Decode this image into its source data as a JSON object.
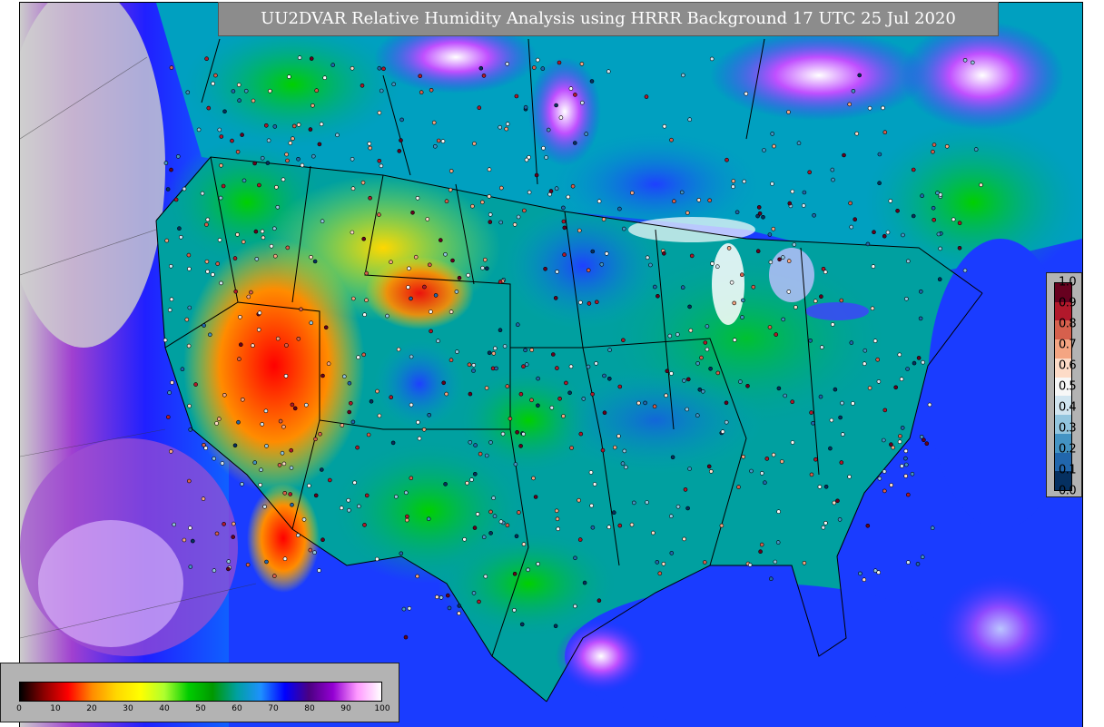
{
  "title": "UU2DVAR Relative Humidity Analysis using HRRR Background 17 UTC 25 Jul 2020",
  "field_colorbar": {
    "tick_labels": [
      "0",
      "10",
      "20",
      "30",
      "40",
      "50",
      "60",
      "70",
      "80",
      "90",
      "100"
    ],
    "range": [
      0,
      100
    ],
    "colors": [
      "#000000",
      "#8b0000",
      "#ff0000",
      "#ff8c00",
      "#ffd700",
      "#ffff00",
      "#adff2f",
      "#00cc00",
      "#009900",
      "#00a0a0",
      "#1e90ff",
      "#0000ff",
      "#4b0082",
      "#9400d3",
      "#ff99ff",
      "#ffffff"
    ]
  },
  "obs_colorbar": {
    "tick_labels": [
      "1.0",
      "0.9",
      "0.8",
      "0.7",
      "0.6",
      "0.5",
      "0.4",
      "0.3",
      "0.2",
      "0.1",
      "0.0"
    ],
    "range": [
      0.0,
      1.0
    ],
    "colors": [
      "#67001f",
      "#b2182b",
      "#d6604d",
      "#f4a582",
      "#fddbc7",
      "#f7f7f7",
      "#d1e5f0",
      "#92c5de",
      "#4393c3",
      "#2166ac",
      "#053061"
    ]
  },
  "map": {
    "land_color": "#c8c8c8",
    "ocean_color": "#1a3cff",
    "border_color": "#000000"
  }
}
